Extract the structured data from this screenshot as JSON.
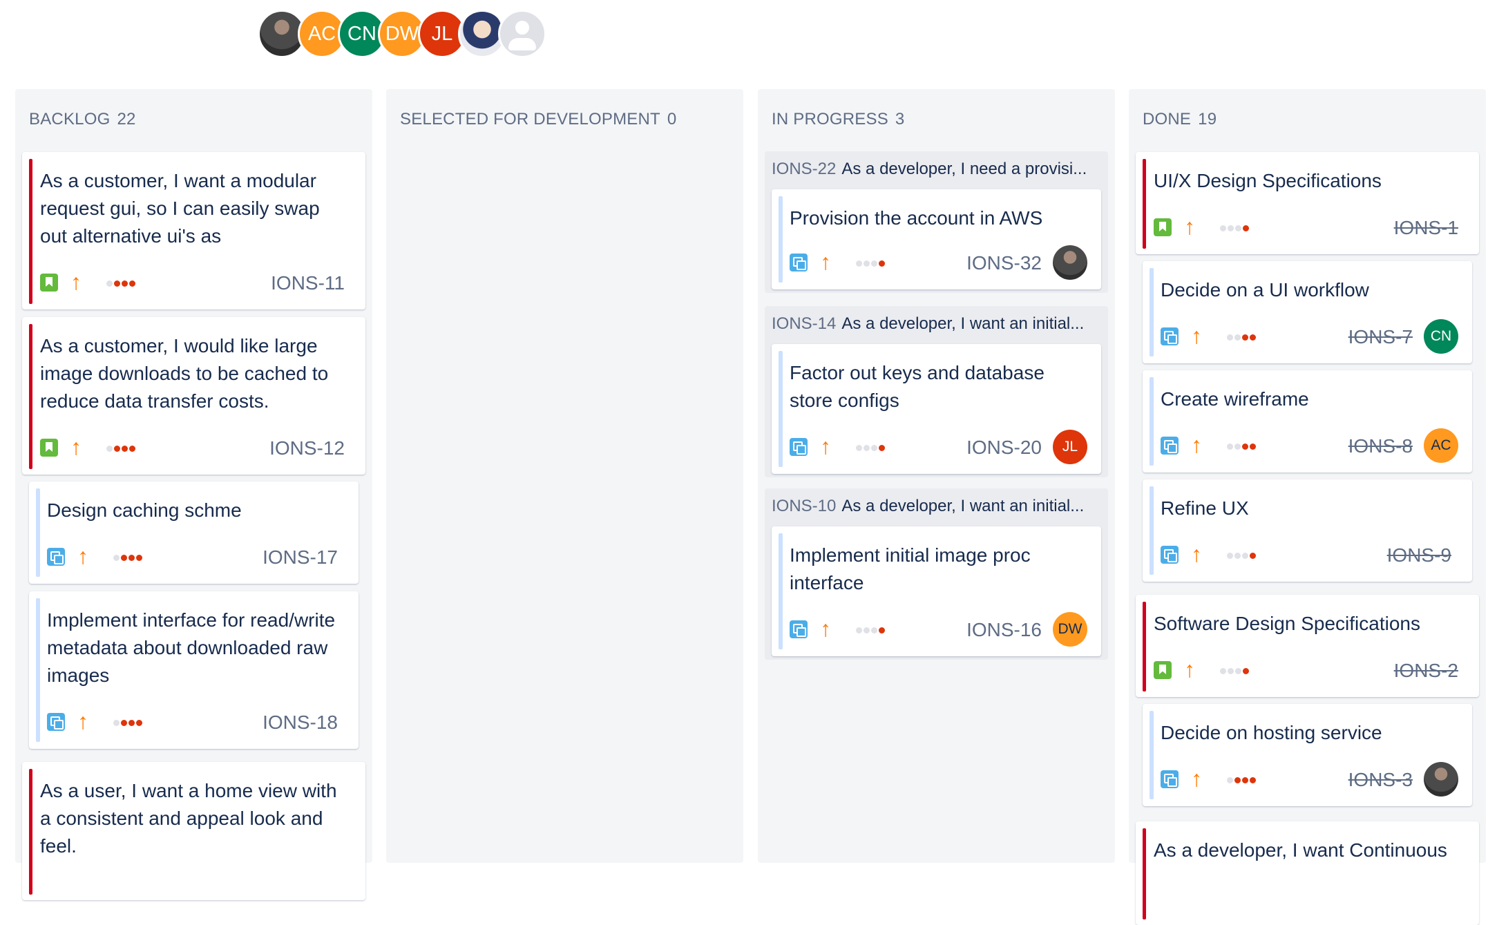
{
  "team_avatars": [
    {
      "name": "user-photo-1",
      "initials": "",
      "color": "#4a4a4a"
    },
    {
      "name": "AC",
      "initials": "AC",
      "color": "#ff991f"
    },
    {
      "name": "CN",
      "initials": "CN",
      "color": "#00875a"
    },
    {
      "name": "DW",
      "initials": "DW",
      "color": "#ff991f"
    },
    {
      "name": "JL",
      "initials": "JL",
      "color": "#de350b"
    },
    {
      "name": "user-photo-2",
      "initials": "",
      "color": "#2a3b6b"
    },
    {
      "name": "unassigned",
      "initials": "",
      "color": "#dfe1e6"
    }
  ],
  "columns": [
    {
      "title": "BACKLOG",
      "count": "22",
      "cards": [
        {
          "title": "As a customer, I want a modular request gui, so I can easily swap out alternative ui's as",
          "type": "story-icon",
          "key": "IONS-11"
        },
        {
          "title": "As a customer, I would like large image downloads to be cached to reduce data transfer costs.",
          "type": "story-icon",
          "key": "IONS-12"
        },
        {
          "title": "Design caching schme",
          "type": "subtask-icon",
          "key": "IONS-17"
        },
        {
          "title": "Implement interface for read/write metadata about downloaded raw images",
          "type": "subtask-icon",
          "key": "IONS-18"
        },
        {
          "title": "As a user, I want a home view with a consistent and appeal look and feel.",
          "type": "story-icon",
          "key": ""
        }
      ]
    },
    {
      "title": "SELECTED FOR DEVELOPMENT",
      "count": "0",
      "cards": []
    },
    {
      "title": "IN PROGRESS",
      "count": "3",
      "groups": [
        {
          "key": "IONS-22",
          "summary": "As a developer, I need a provisi...",
          "card": {
            "title": "Provision the account in AWS",
            "key": "IONS-32",
            "assignee": "photo"
          }
        },
        {
          "key": "IONS-14",
          "summary": "As a developer, I want an initial...",
          "card": {
            "title": "Factor out keys and database store configs",
            "key": "IONS-20",
            "assignee": "JL"
          }
        },
        {
          "key": "IONS-10",
          "summary": "As a developer, I want an initial...",
          "card": {
            "title": "Implement initial image proc interface",
            "key": "IONS-16",
            "assignee": "DW"
          }
        }
      ]
    },
    {
      "title": "DONE",
      "count": "19",
      "cards": [
        {
          "title": "UI/X Design Specifications",
          "key": "IONS-1",
          "assignee": ""
        },
        {
          "title": "Decide on a UI workflow",
          "key": "IONS-7",
          "assignee": "CN"
        },
        {
          "title": "Create wireframe",
          "key": "IONS-8",
          "assignee": "AC"
        },
        {
          "title": "Refine UX",
          "key": "IONS-9",
          "assignee": ""
        },
        {
          "title": "Software Design Specifications",
          "key": "IONS-2",
          "assignee": ""
        },
        {
          "title": "Decide on hosting service",
          "key": "IONS-3",
          "assignee": "photo"
        },
        {
          "title": "As a developer, I want Continuous",
          "key": "",
          "assignee": ""
        }
      ]
    }
  ],
  "colors": {
    "epic_stripe": "#d0021b",
    "subtask_stripe": "#cce0ff",
    "priority": "#ff7a00",
    "dot_active": "#de350b"
  }
}
